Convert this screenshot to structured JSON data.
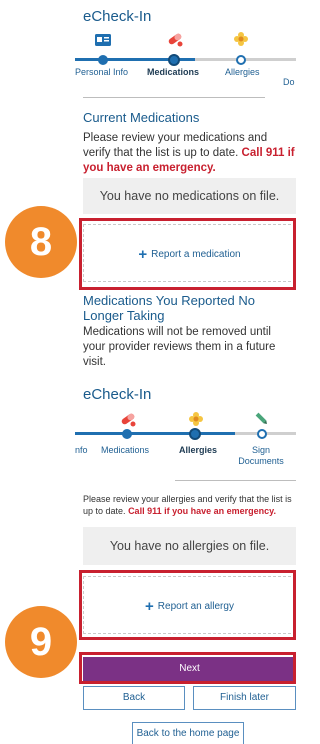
{
  "panel1": {
    "title": "eCheck-In",
    "steps": [
      {
        "label": "Personal Info",
        "icon": "id-card-icon",
        "state": "done"
      },
      {
        "label": "Medications",
        "icon": "pills-icon",
        "state": "active"
      },
      {
        "label": "Allergies",
        "icon": "flower-icon",
        "state": "todo"
      },
      {
        "label": "Do",
        "icon": "",
        "state": "todo"
      }
    ],
    "section_title": "Current Medications",
    "instructions": "Please review your medications and verify that the list is up to date.",
    "emergency": "Call 911 if you have an emergency.",
    "empty_message": "You have no medications on file.",
    "report_button": "Report a medication",
    "no_longer_title": "Medications You Reported No Longer Taking",
    "no_longer_text": "Medications will not be removed until your provider reviews them in a future visit.",
    "badge": "8"
  },
  "panel2": {
    "title": "eCheck-In",
    "steps": [
      {
        "label": "nfo",
        "icon": "",
        "state": "done"
      },
      {
        "label": "Medications",
        "icon": "pills-icon",
        "state": "done"
      },
      {
        "label": "Allergies",
        "icon": "flower-icon",
        "state": "active"
      },
      {
        "label": "Sign Documents",
        "icon": "pen-icon",
        "state": "todo"
      }
    ],
    "instructions": "Please review your allergies and verify that the list is up to date.",
    "emergency": "Call 911 if you have an emergency.",
    "empty_message": "You have no allergies on file.",
    "report_button": "Report an allergy",
    "next_button": "Next",
    "back_button": "Back",
    "finish_later_button": "Finish later",
    "home_button": "Back to the home page",
    "badge": "9"
  },
  "colors": {
    "accent": "#1f6fb0",
    "highlight": "#c8202f",
    "badge": "#f08a2c",
    "primary_button": "#7b3185"
  }
}
